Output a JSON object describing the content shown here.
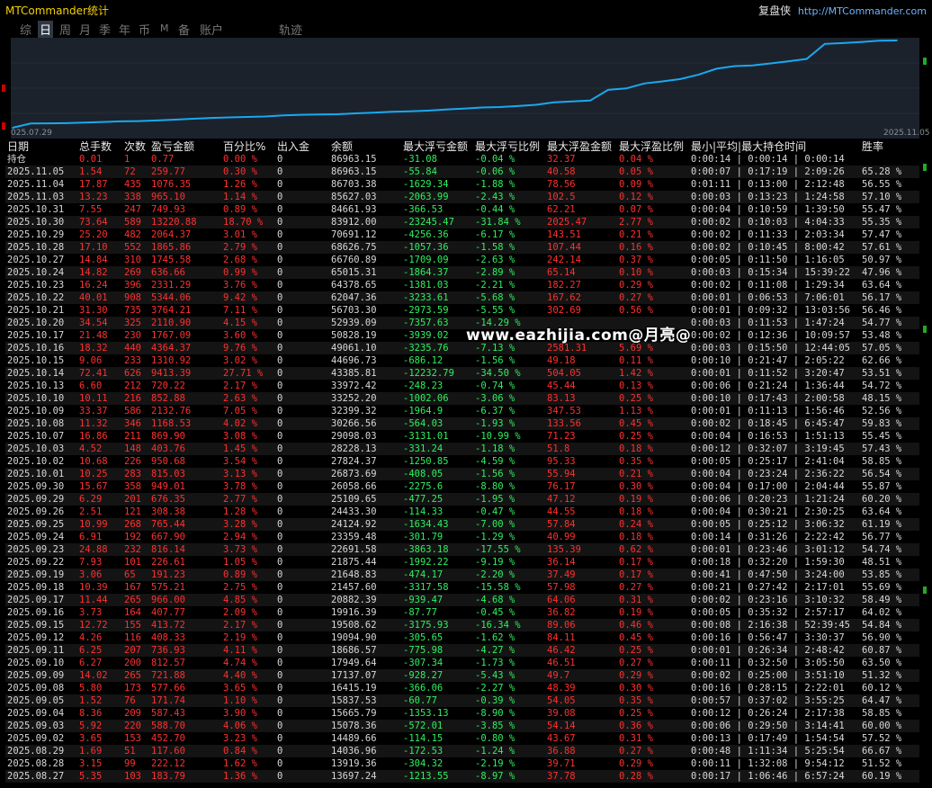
{
  "app_title": "MTCommander统计",
  "brand": {
    "name": "复盘侠",
    "url": "http://MTCommander.com"
  },
  "tabs": [
    "综",
    "日",
    "周",
    "月",
    "季",
    "年",
    "币",
    "M",
    "备",
    "账户",
    "轨迹"
  ],
  "active_tab": "日",
  "watermark": "www.eazhijia.com@月亮@",
  "colors": {
    "profit_red": "#ff3030",
    "loss_green": "#2ef060",
    "curve": "#19a9f0",
    "chart_bg": "#1c222c"
  },
  "chart_data": {
    "type": "line",
    "x_start_label": "025.07.29",
    "x_end_label": "2025.11.05",
    "series": [
      {
        "name": "",
        "x": [
          "2025.07.29",
          "2025.08.27",
          "2025.08.28",
          "2025.08.29",
          "2025.09.02",
          "2025.09.03",
          "2025.09.04",
          "2025.09.05",
          "2025.09.08",
          "2025.09.09",
          "2025.09.10",
          "2025.09.11",
          "2025.09.12",
          "2025.09.15",
          "2025.09.16",
          "2025.09.17",
          "2025.09.18",
          "2025.09.19",
          "2025.09.22",
          "2025.09.23",
          "2025.09.24",
          "2025.09.25",
          "2025.09.26",
          "2025.09.29",
          "2025.09.30",
          "2025.10.01",
          "2025.10.02",
          "2025.10.03",
          "2025.10.07",
          "2025.10.08",
          "2025.10.09",
          "2025.10.10",
          "2025.10.13",
          "2025.10.14",
          "2025.10.15",
          "2025.10.16",
          "2025.10.17",
          "2025.10.20",
          "2025.10.21",
          "2025.10.22",
          "2025.10.23",
          "2025.10.24",
          "2025.10.27",
          "2025.10.28",
          "2025.10.29",
          "2025.10.30",
          "2025.10.31",
          "2025.11.03",
          "2025.11.04",
          "2025.11.05"
        ],
        "values": [
          10000,
          13697.24,
          13919.36,
          14036.96,
          14489.66,
          15078.36,
          15665.79,
          15837.53,
          16415.19,
          17137.07,
          17949.64,
          18686.57,
          19094.9,
          19508.62,
          19916.39,
          20882.39,
          21457.6,
          21648.83,
          21875.44,
          22691.58,
          23359.48,
          24124.92,
          24433.3,
          25109.65,
          26058.66,
          26873.69,
          27824.37,
          28228.13,
          29098.03,
          30266.56,
          32399.32,
          33252.2,
          33972.42,
          43385.81,
          44696.73,
          49061.1,
          50828.19,
          52939.09,
          56703.3,
          62047.36,
          64378.65,
          65015.31,
          66760.89,
          68626.75,
          70691.12,
          83912.0,
          84661.93,
          85627.03,
          86703.38,
          86963.15
        ]
      }
    ]
  },
  "table": {
    "headers": [
      "日期",
      "总手数",
      "次数",
      "盈亏金额",
      "百分比%",
      "出入金",
      "余额",
      "最大浮亏金额",
      "最大浮亏比例",
      "最大浮盈金额",
      "最大浮盈比例",
      "最小|平均|最大持仓时间",
      "胜率"
    ],
    "position_row": [
      "持仓",
      "0.01",
      "1",
      "0.77",
      "0.00 %",
      "0",
      "86963.15",
      "-31.08",
      "-0.04 %",
      "32.37",
      "0.04 %",
      "0:00:14 | 0:00:14 | 0:00:14",
      ""
    ],
    "rows": [
      [
        "2025.11.05",
        "1.54",
        "72",
        "259.77",
        "0.30 %",
        "0",
        "86963.15",
        "-55.84",
        "-0.06 %",
        "40.58",
        "0.05 %",
        "0:00:07 | 0:17:19 | 2:09:26",
        "65.28 %"
      ],
      [
        "2025.11.04",
        "17.87",
        "435",
        "1076.35",
        "1.26 %",
        "0",
        "86703.38",
        "-1629.34",
        "-1.88 %",
        "78.56",
        "0.09 %",
        "0:01:11 | 0:13:00 | 2:12:48",
        "56.55 %"
      ],
      [
        "2025.11.03",
        "13.23",
        "338",
        "965.10",
        "1.14 %",
        "0",
        "85627.03",
        "-2063.99",
        "-2.43 %",
        "102.5",
        "0.12 %",
        "0:00:03 | 0:13:23 | 1:24:58",
        "57.10 %"
      ],
      [
        "2025.10.31",
        "7.55",
        "247",
        "749.93",
        "0.89 %",
        "0",
        "84661.93",
        "-366.53",
        "-0.44 %",
        "62.21",
        "0.07 %",
        "0:00:04 | 0:10:59 | 1:39:50",
        "55.47 %"
      ],
      [
        "2025.10.30",
        "73.64",
        "589",
        "13220.88",
        "18.70 %",
        "0",
        "83912.00",
        "-23245.47",
        "-31.84 %",
        "2025.47",
        "2.77 %",
        "0:00:02 | 0:10:03 | 4:04:33",
        "55.35 %"
      ],
      [
        "2025.10.29",
        "25.20",
        "482",
        "2064.37",
        "3.01 %",
        "0",
        "70691.12",
        "-4256.36",
        "-6.17 %",
        "143.51",
        "0.21 %",
        "0:00:02 | 0:11:33 | 2:03:34",
        "57.47 %"
      ],
      [
        "2025.10.28",
        "17.10",
        "552",
        "1865.86",
        "2.79 %",
        "0",
        "68626.75",
        "-1057.36",
        "-1.58 %",
        "107.44",
        "0.16 %",
        "0:00:02 | 0:10:45 | 8:00:42",
        "57.61 %"
      ],
      [
        "2025.10.27",
        "14.84",
        "310",
        "1745.58",
        "2.68 %",
        "0",
        "66760.89",
        "-1709.09",
        "-2.63 %",
        "242.14",
        "0.37 %",
        "0:00:05 | 0:11:50 | 1:16:05",
        "50.97 %"
      ],
      [
        "2025.10.24",
        "14.82",
        "269",
        "636.66",
        "0.99 %",
        "0",
        "65015.31",
        "-1864.37",
        "-2.89 %",
        "65.14",
        "0.10 %",
        "0:00:03 | 0:15:34 | 15:39:22",
        "47.96 %"
      ],
      [
        "2025.10.23",
        "16.24",
        "396",
        "2331.29",
        "3.76 %",
        "0",
        "64378.65",
        "-1381.03",
        "-2.21 %",
        "182.27",
        "0.29 %",
        "0:00:02 | 0:11:08 | 1:29:34",
        "63.64 %"
      ],
      [
        "2025.10.22",
        "40.01",
        "908",
        "5344.06",
        "9.42 %",
        "0",
        "62047.36",
        "-3233.61",
        "-5.68 %",
        "167.62",
        "0.27 %",
        "0:00:01 | 0:06:53 | 7:06:01",
        "56.17 %"
      ],
      [
        "2025.10.21",
        "31.30",
        "735",
        "3764.21",
        "7.11 %",
        "0",
        "56703.30",
        "-2973.59",
        "-5.55 %",
        "302.69",
        "0.56 %",
        "0:00:01 | 0:09:32 | 13:03:56",
        "56.46 %"
      ],
      [
        "2025.10.20",
        "34.54",
        "325",
        "2110.90",
        "4.15 %",
        "0",
        "52939.09",
        "-7357.63",
        "-14.29 %",
        "",
        "",
        "0:00:03 | 0:11:53 | 1:47:24",
        "54.77 %"
      ],
      [
        "2025.10.17",
        "21.48",
        "230",
        "1767.09",
        "3.60 %",
        "0",
        "50828.19",
        "-3939.02",
        "",
        "",
        "",
        "0:00:02 | 0:12:36 | 10:09:57",
        "53.48 %"
      ],
      [
        "2025.10.16",
        "18.32",
        "440",
        "4364.37",
        "9.76 %",
        "0",
        "49061.10",
        "-3235.76",
        "-7.13 %",
        "2581.31",
        "5.69 %",
        "0:00:03 | 0:15:50 | 12:44:05",
        "57.05 %"
      ],
      [
        "2025.10.15",
        "9.06",
        "233",
        "1310.92",
        "3.02 %",
        "0",
        "44696.73",
        "-686.12",
        "-1.56 %",
        "49.18",
        "0.11 %",
        "0:00:10 | 0:21:47 | 2:05:22",
        "62.66 %"
      ],
      [
        "2025.10.14",
        "72.41",
        "626",
        "9413.39",
        "27.71 %",
        "0",
        "43385.81",
        "-12232.79",
        "-34.50 %",
        "504.05",
        "1.42 %",
        "0:00:01 | 0:11:52 | 3:20:47",
        "53.51 %"
      ],
      [
        "2025.10.13",
        "6.60",
        "212",
        "720.22",
        "2.17 %",
        "0",
        "33972.42",
        "-248.23",
        "-0.74 %",
        "45.44",
        "0.13 %",
        "0:00:06 | 0:21:24 | 1:36:44",
        "54.72 %"
      ],
      [
        "2025.10.10",
        "10.11",
        "216",
        "852.88",
        "2.63 %",
        "0",
        "33252.20",
        "-1002.06",
        "-3.06 %",
        "83.13",
        "0.25 %",
        "0:00:10 | 0:17:43 | 2:00:58",
        "48.15 %"
      ],
      [
        "2025.10.09",
        "33.37",
        "586",
        "2132.76",
        "7.05 %",
        "0",
        "32399.32",
        "-1964.9",
        "-6.37 %",
        "347.53",
        "1.13 %",
        "0:00:01 | 0:11:13 | 1:56:46",
        "52.56 %"
      ],
      [
        "2025.10.08",
        "11.32",
        "346",
        "1168.53",
        "4.02 %",
        "0",
        "30266.56",
        "-564.03",
        "-1.93 %",
        "133.56",
        "0.45 %",
        "0:00:02 | 0:18:45 | 6:45:47",
        "59.83 %"
      ],
      [
        "2025.10.07",
        "16.86",
        "211",
        "869.90",
        "3.08 %",
        "0",
        "29098.03",
        "-3131.01",
        "-10.99 %",
        "71.23",
        "0.25 %",
        "0:00:04 | 0:16:53 | 1:51:13",
        "55.45 %"
      ],
      [
        "2025.10.03",
        "4.52",
        "148",
        "403.76",
        "1.45 %",
        "0",
        "28228.13",
        "-331.24",
        "-1.18 %",
        "51.8",
        "0.18 %",
        "0:00:12 | 0:32:07 | 3:19:45",
        "57.43 %"
      ],
      [
        "2025.10.02",
        "10.68",
        "226",
        "950.68",
        "3.54 %",
        "0",
        "27824.37",
        "-1250.85",
        "-4.59 %",
        "95.33",
        "0.35 %",
        "0:00:05 | 0:25:17 | 2:41:04",
        "58.85 %"
      ],
      [
        "2025.10.01",
        "10.25",
        "283",
        "815.03",
        "3.13 %",
        "0",
        "26873.69",
        "-408.05",
        "-1.56 %",
        "55.94",
        "0.21 %",
        "0:00:04 | 0:23:24 | 2:36:22",
        "56.54 %"
      ],
      [
        "2025.09.30",
        "15.67",
        "358",
        "949.01",
        "3.78 %",
        "0",
        "26058.66",
        "-2275.6",
        "-8.80 %",
        "76.17",
        "0.30 %",
        "0:00:04 | 0:17:00 | 2:04:44",
        "55.87 %"
      ],
      [
        "2025.09.29",
        "6.29",
        "201",
        "676.35",
        "2.77 %",
        "0",
        "25109.65",
        "-477.25",
        "-1.95 %",
        "47.12",
        "0.19 %",
        "0:00:06 | 0:20:23 | 1:21:24",
        "60.20 %"
      ],
      [
        "2025.09.26",
        "2.51",
        "121",
        "308.38",
        "1.28 %",
        "0",
        "24433.30",
        "-114.33",
        "-0.47 %",
        "44.55",
        "0.18 %",
        "0:00:04 | 0:30:21 | 2:30:25",
        "63.64 %"
      ],
      [
        "2025.09.25",
        "10.99",
        "268",
        "765.44",
        "3.28 %",
        "0",
        "24124.92",
        "-1634.43",
        "-7.00 %",
        "57.84",
        "0.24 %",
        "0:00:05 | 0:25:12 | 3:06:32",
        "61.19 %"
      ],
      [
        "2025.09.24",
        "6.91",
        "192",
        "667.90",
        "2.94 %",
        "0",
        "23359.48",
        "-301.79",
        "-1.29 %",
        "40.99",
        "0.18 %",
        "0:00:14 | 0:31:26 | 2:22:42",
        "56.77 %"
      ],
      [
        "2025.09.23",
        "24.88",
        "232",
        "816.14",
        "3.73 %",
        "0",
        "22691.58",
        "-3863.18",
        "-17.55 %",
        "135.39",
        "0.62 %",
        "0:00:01 | 0:23:46 | 3:01:12",
        "54.74 %"
      ],
      [
        "2025.09.22",
        "7.93",
        "101",
        "226.61",
        "1.05 %",
        "0",
        "21875.44",
        "-1992.22",
        "-9.19 %",
        "36.14",
        "0.17 %",
        "0:00:18 | 0:32:20 | 1:59:30",
        "48.51 %"
      ],
      [
        "2025.09.19",
        "3.06",
        "65",
        "191.23",
        "0.89 %",
        "0",
        "21648.83",
        "-474.17",
        "-2.20 %",
        "37.49",
        "0.17 %",
        "0:00:41 | 0:47:50 | 3:24:00",
        "53.85 %"
      ],
      [
        "2025.09.18",
        "10.39",
        "167",
        "575.21",
        "2.75 %",
        "0",
        "21457.60",
        "-3317.58",
        "-15.58 %",
        "57.98",
        "0.27 %",
        "0:00:21 | 0:27:42 | 2:17:01",
        "55.69 %"
      ],
      [
        "2025.09.17",
        "11.44",
        "265",
        "966.00",
        "4.85 %",
        "0",
        "20882.39",
        "-939.47",
        "-4.68 %",
        "64.06",
        "0.31 %",
        "0:00:02 | 0:23:16 | 3:10:32",
        "58.49 %"
      ],
      [
        "2025.09.16",
        "3.73",
        "164",
        "407.77",
        "2.09 %",
        "0",
        "19916.39",
        "-87.77",
        "-0.45 %",
        "36.82",
        "0.19 %",
        "0:00:05 | 0:35:32 | 2:57:17",
        "64.02 %"
      ],
      [
        "2025.09.15",
        "12.72",
        "155",
        "413.72",
        "2.17 %",
        "0",
        "19508.62",
        "-3175.93",
        "-16.34 %",
        "89.06",
        "0.46 %",
        "0:00:08 | 2:16:38 | 52:39:45",
        "54.84 %"
      ],
      [
        "2025.09.12",
        "4.26",
        "116",
        "408.33",
        "2.19 %",
        "0",
        "19094.90",
        "-305.65",
        "-1.62 %",
        "84.11",
        "0.45 %",
        "0:00:16 | 0:56:47 | 3:30:37",
        "56.90 %"
      ],
      [
        "2025.09.11",
        "6.25",
        "207",
        "736.93",
        "4.11 %",
        "0",
        "18686.57",
        "-775.98",
        "-4.27 %",
        "46.42",
        "0.25 %",
        "0:00:01 | 0:26:34 | 2:48:42",
        "60.87 %"
      ],
      [
        "2025.09.10",
        "6.27",
        "200",
        "812.57",
        "4.74 %",
        "0",
        "17949.64",
        "-307.34",
        "-1.73 %",
        "46.51",
        "0.27 %",
        "0:00:11 | 0:32:50 | 3:05:50",
        "63.50 %"
      ],
      [
        "2025.09.09",
        "14.02",
        "265",
        "721.88",
        "4.40 %",
        "0",
        "17137.07",
        "-928.27",
        "-5.43 %",
        "49.7",
        "0.29 %",
        "0:00:02 | 0:25:00 | 3:51:10",
        "51.32 %"
      ],
      [
        "2025.09.08",
        "5.80",
        "173",
        "577.66",
        "3.65 %",
        "0",
        "16415.19",
        "-366.06",
        "-2.27 %",
        "48.39",
        "0.30 %",
        "0:00:16 | 0:28:15 | 2:22:01",
        "60.12 %"
      ],
      [
        "2025.09.05",
        "1.52",
        "76",
        "171.74",
        "1.10 %",
        "0",
        "15837.53",
        "-60.77",
        "-0.39 %",
        "54.05",
        "0.35 %",
        "0:00:57 | 0:37:02 | 3:55:25",
        "64.47 %"
      ],
      [
        "2025.09.04",
        "8.36",
        "209",
        "587.43",
        "3.90 %",
        "0",
        "15665.79",
        "-1353.13",
        "-8.90 %",
        "39.08",
        "0.25 %",
        "0:00:12 | 0:26:24 | 2:17:38",
        "58.85 %"
      ],
      [
        "2025.09.03",
        "5.92",
        "220",
        "588.70",
        "4.06 %",
        "0",
        "15078.36",
        "-572.01",
        "-3.85 %",
        "54.14",
        "0.36 %",
        "0:00:06 | 0:29:50 | 3:14:41",
        "60.00 %"
      ],
      [
        "2025.09.02",
        "3.65",
        "153",
        "452.70",
        "3.23 %",
        "0",
        "14489.66",
        "-114.15",
        "-0.80 %",
        "43.67",
        "0.31 %",
        "0:00:13 | 0:17:49 | 1:54:54",
        "57.52 %"
      ],
      [
        "2025.08.29",
        "1.69",
        "51",
        "117.60",
        "0.84 %",
        "0",
        "14036.96",
        "-172.53",
        "-1.24 %",
        "36.88",
        "0.27 %",
        "0:00:48 | 1:11:34 | 5:25:54",
        "66.67 %"
      ],
      [
        "2025.08.28",
        "3.15",
        "99",
        "222.12",
        "1.62 %",
        "0",
        "13919.36",
        "-304.32",
        "-2.19 %",
        "39.71",
        "0.29 %",
        "0:00:11 | 1:32:08 | 9:54:12",
        "51.52 %"
      ],
      [
        "2025.08.27",
        "5.35",
        "103",
        "183.79",
        "1.36 %",
        "0",
        "13697.24",
        "-1213.55",
        "-8.97 %",
        "37.78",
        "0.28 %",
        "0:00:17 | 1:06:46 | 6:57:24",
        "60.19 %"
      ]
    ]
  }
}
